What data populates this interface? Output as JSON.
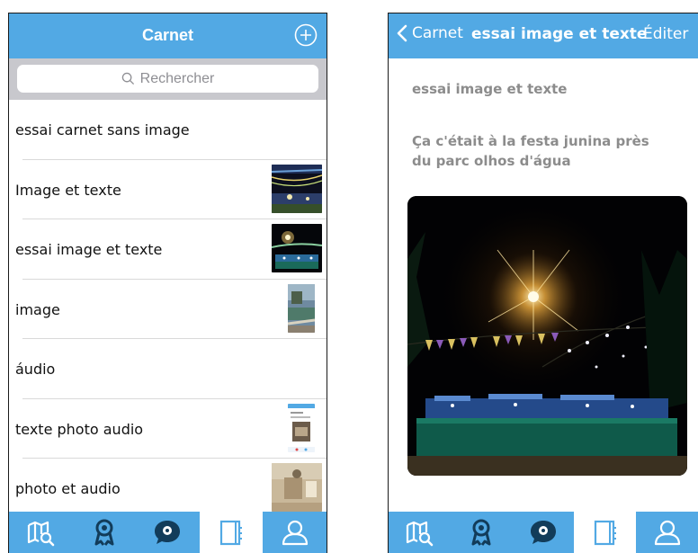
{
  "left": {
    "header": {
      "title": "Carnet"
    },
    "search": {
      "placeholder": "Rechercher"
    },
    "items": [
      {
        "label": "essai carnet sans image",
        "thumbnail": ""
      },
      {
        "label": "Image et texte",
        "thumbnail": "night-festival-lights"
      },
      {
        "label": "essai image et texte",
        "thumbnail": "night-festival-flags"
      },
      {
        "label": "image",
        "thumbnail": "building-balcony"
      },
      {
        "label": "áudio",
        "thumbnail": ""
      },
      {
        "label": "texte photo audio",
        "thumbnail": "app-screenshot"
      },
      {
        "label": "photo et audio",
        "thumbnail": "sand-ground"
      }
    ],
    "tabs": [
      "map-search-icon",
      "award-icon",
      "chat-location-icon",
      "notebook-icon",
      "user-icon"
    ],
    "active_tab": 3
  },
  "right": {
    "header": {
      "back_label": "Carnet",
      "title": "essai image et texte",
      "edit_label": "Éditer"
    },
    "note": {
      "title": "essai image et texte",
      "text": "Ça c'était à la festa junina près du parc olhos d'água"
    },
    "photo": "night-festival-flags",
    "tabs": [
      "map-search-icon",
      "award-icon",
      "chat-location-icon",
      "notebook-icon",
      "user-icon"
    ],
    "active_tab": 3
  },
  "colors": {
    "accent": "#52a9e4",
    "search_band": "#c8c8cd",
    "muted_text": "#8c8c8c"
  }
}
